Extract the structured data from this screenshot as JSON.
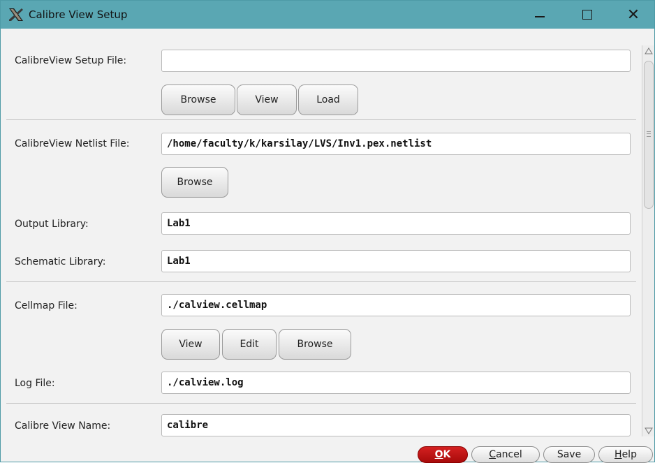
{
  "window": {
    "title": "Calibre View Setup",
    "icons": {
      "app": "x-logo-icon",
      "minimize": "minimize-icon",
      "maximize": "maximize-icon",
      "close": "close-icon"
    },
    "close_glyph": "✕"
  },
  "form": {
    "setup_file": {
      "label": "CalibreView Setup File:",
      "value": ""
    },
    "setup_buttons": {
      "browse": "Browse",
      "view": "View",
      "load": "Load"
    },
    "netlist_file": {
      "label": "CalibreView Netlist File:",
      "value": "/home/faculty/k/karsilay/LVS/Inv1.pex.netlist"
    },
    "netlist_buttons": {
      "browse": "Browse"
    },
    "output_library": {
      "label": "Output Library:",
      "value": "Lab1"
    },
    "schematic_library": {
      "label": "Schematic Library:",
      "value": "Lab1"
    },
    "cellmap_file": {
      "label": "Cellmap File:",
      "value": "./calview.cellmap"
    },
    "cellmap_buttons": {
      "view": "View",
      "edit": "Edit",
      "browse": "Browse"
    },
    "log_file": {
      "label": "Log File:",
      "value": "./calview.log"
    },
    "view_name": {
      "label": "Calibre View Name:",
      "value": "calibre"
    }
  },
  "footer": {
    "ok": {
      "mnemonic": "O",
      "rest": "K"
    },
    "cancel": {
      "mnemonic": "C",
      "rest": "ancel"
    },
    "save": "Save",
    "help": {
      "mnemonic": "H",
      "rest": "elp"
    }
  },
  "colors": {
    "titlebar": "#5aa7b3",
    "ok_button": "#c01010",
    "background": "#f2f2f2"
  }
}
